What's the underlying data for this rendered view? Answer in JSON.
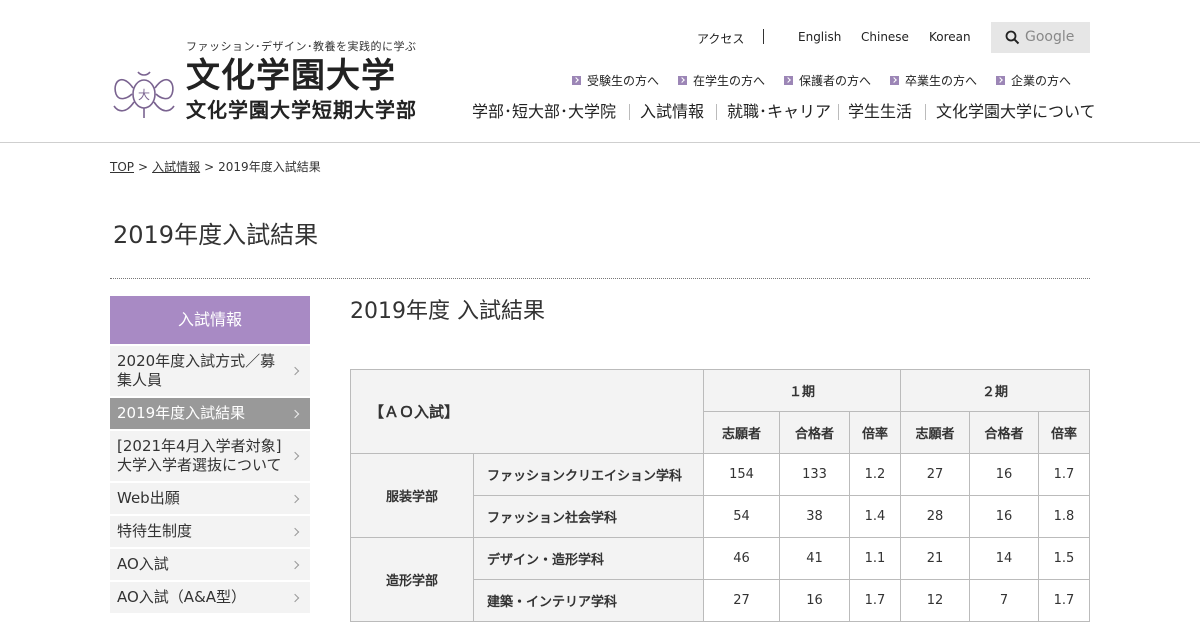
{
  "header": {
    "tagline": "ファッション･デザイン･教養を実践的に学ぶ",
    "logo_name_1": "文化学園大学",
    "logo_name_2": "文化学園大学短期大学部",
    "logo_icon": "crest-logo-icon",
    "utility_links": [
      "アクセス",
      "English",
      "Chinese",
      "Korean"
    ],
    "search": {
      "placeholder": "Google",
      "icon": "search-icon"
    },
    "audience_links": [
      "受験生の方へ",
      "在学生の方へ",
      "保護者の方へ",
      "卒業生の方へ",
      "企業の方へ"
    ],
    "global_nav": [
      "学部･短大部･大学院",
      "入試情報",
      "就職･キャリア",
      "学生生活",
      "文化学園大学について"
    ],
    "colors": {
      "accent": "#a88ac4",
      "bullet": "#9c86b6"
    }
  },
  "breadcrumb": {
    "items": [
      "TOP",
      "入試情報",
      "2019年度入試結果"
    ],
    "separator": ">"
  },
  "page_title": "2019年度入試結果",
  "sidebar": {
    "heading": "入試情報",
    "items": [
      {
        "label": "2020年度入試方式／募集人員",
        "active": false
      },
      {
        "label": "2019年度入試結果",
        "active": true
      },
      {
        "label": "[2021年4月入学者対象]大学入学者選抜について",
        "active": false
      },
      {
        "label": "Web出願",
        "active": false
      },
      {
        "label": "特待生制度",
        "active": false
      },
      {
        "label": "AO入試",
        "active": false
      },
      {
        "label": "AO入試（A&A型）",
        "active": false
      }
    ]
  },
  "main": {
    "heading": "2019年度 入試結果",
    "table": {
      "corner_label": "【ＡＯ入試】",
      "period_headers": [
        "１期",
        "２期"
      ],
      "sub_headers": [
        "志願者",
        "合格者",
        "倍率",
        "志願者",
        "合格者",
        "倍率"
      ],
      "faculties": [
        {
          "name": "服装学部",
          "rows": [
            {
              "dept": "ファッションクリエイション学科",
              "values": [
                "154",
                "133",
                "1.2",
                "27",
                "16",
                "1.7"
              ]
            },
            {
              "dept": "ファッション社会学科",
              "values": [
                "54",
                "38",
                "1.4",
                "28",
                "16",
                "1.8"
              ]
            }
          ]
        },
        {
          "name": "造形学部",
          "rows": [
            {
              "dept": "デザイン・造形学科",
              "values": [
                "46",
                "41",
                "1.1",
                "21",
                "14",
                "1.5"
              ]
            },
            {
              "dept": "建築・インテリア学科",
              "values": [
                "27",
                "16",
                "1.7",
                "12",
                "7",
                "1.7"
              ]
            }
          ]
        }
      ]
    }
  }
}
